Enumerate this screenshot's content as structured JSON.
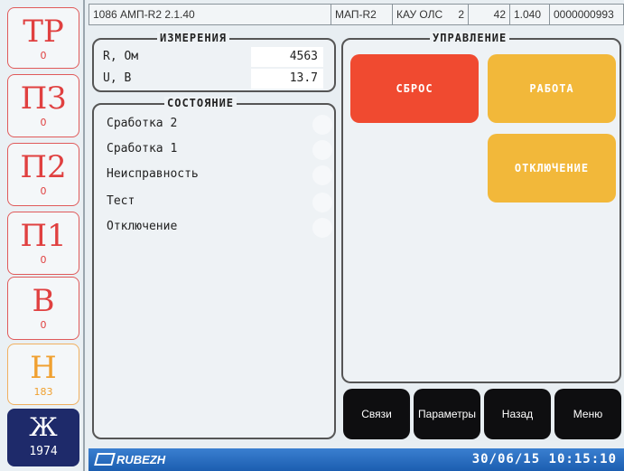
{
  "sidebar": {
    "items": [
      {
        "label": "ТР",
        "count": "0",
        "color": "#e04040"
      },
      {
        "label": "ПЗ",
        "count": "0",
        "color": "#e04040"
      },
      {
        "label": "П2",
        "count": "0",
        "color": "#e04040"
      },
      {
        "label": "П1",
        "count": "0",
        "color": "#e04040"
      },
      {
        "label": "В",
        "count": "0",
        "color": "#e04040"
      },
      {
        "label": "Н",
        "count": "183",
        "color": "#f0a030"
      },
      {
        "label": "Ж",
        "count": "1974",
        "color": "#1e2a6a"
      }
    ]
  },
  "topbar": {
    "device": "1086 АМП-R2 2.1.40",
    "module": "МАП-R2",
    "kau_label": "КАУ ОЛС",
    "kau_num": "2",
    "addr": "42",
    "version": "1.040",
    "serial": "0000000993"
  },
  "measurements": {
    "title": "ИЗМЕРЕНИЯ",
    "rows": [
      {
        "label": "R, Ом",
        "value": "4563"
      },
      {
        "label": "U, В",
        "value": "13.7"
      }
    ]
  },
  "state": {
    "title": "СОСТОЯНИЕ",
    "items": [
      "Сработка 2",
      "Сработка 1",
      "Неисправность",
      "Тест",
      "Отключение"
    ]
  },
  "control": {
    "title": "УПРАВЛЕНИЕ",
    "reset": "СБРОС",
    "work": "РАБОТА",
    "disable": "ОТКЛЮЧЕНИЕ"
  },
  "nav": {
    "links": "Связи",
    "params": "Параметры",
    "back": "Назад",
    "menu": "Меню"
  },
  "status": {
    "brand": "RUBEZH",
    "datetime": "30/06/15 10:15:10"
  },
  "colors": {
    "accent_red": "#f04a30",
    "accent_orange": "#f2b83a",
    "status_blue": "#1c5eb0"
  }
}
